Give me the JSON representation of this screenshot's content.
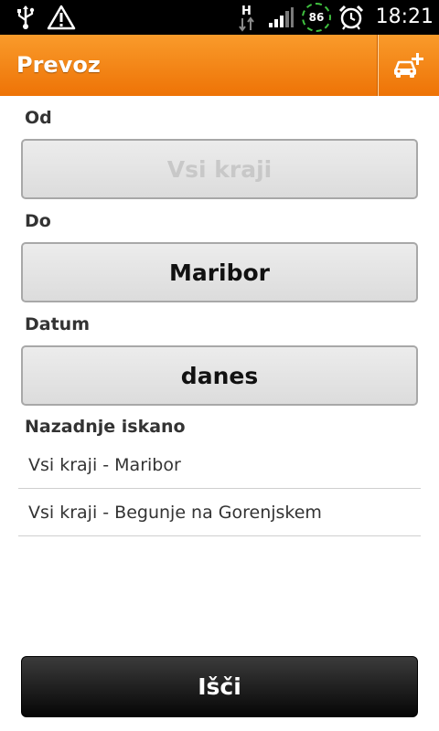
{
  "status_bar": {
    "icons": [
      "usb-icon",
      "warning-icon",
      "network-h-icon",
      "signal-icon",
      "battery-icon",
      "alarm-icon"
    ],
    "battery_level": "86",
    "time": "18:21"
  },
  "action_bar": {
    "title": "Prevoz",
    "action_icon": "add-car-icon",
    "color": "#f2820f"
  },
  "form": {
    "from_label": "Od",
    "from_value": "Vsi kraji",
    "to_label": "Do",
    "to_value": "Maribor",
    "date_label": "Datum",
    "date_value": "danes"
  },
  "recent": {
    "header": "Nazadnje iskano",
    "items": [
      {
        "label": "Vsi kraji - Maribor"
      },
      {
        "label": "Vsi kraji - Begunje na Gorenjskem"
      }
    ]
  },
  "search_button": {
    "label": "Išči"
  }
}
